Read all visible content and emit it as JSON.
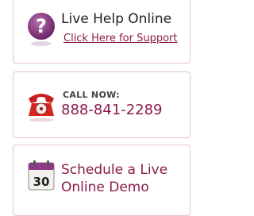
{
  "help": {
    "title": "Live Help Online",
    "link": "Click Here for Support",
    "icon": "question-mark-icon"
  },
  "call": {
    "label": "CALL NOW:",
    "number": "888-841-2289",
    "icon": "red-telephone-icon"
  },
  "demo": {
    "text": "Schedule a Live Online Demo",
    "calendar_day": "30",
    "icon": "calendar-icon"
  },
  "colors": {
    "accent": "#8b1b4a",
    "card_border": "#e3c4cc",
    "help_icon": "#8e3a86",
    "phone_icon": "#c8201e"
  }
}
